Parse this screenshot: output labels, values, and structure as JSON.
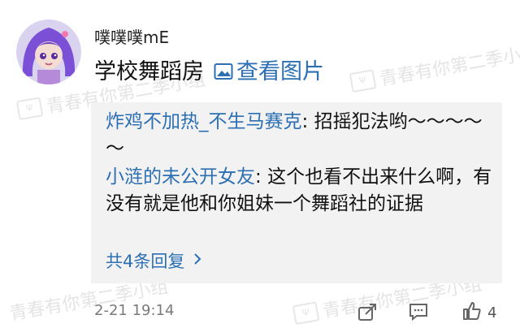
{
  "comment": {
    "username": "噗噗噗mE",
    "text": "学校舞蹈房",
    "view_image_label": "查看图片",
    "timestamp": "2-21 19:14",
    "like_count": "4"
  },
  "replies": [
    {
      "author": "炸鸡不加热_不生马赛克",
      "separator": ": ",
      "text": "招摇犯法哟～～～～～"
    },
    {
      "author": "小涟的未公开女友",
      "separator": ": ",
      "text": "这个也看不出来什么啊，有没有就是他和你姐妹一个舞蹈社的证据"
    }
  ],
  "more_replies_label": "共4条回复",
  "watermark_text": "青春有你第二季小组",
  "colors": {
    "link": "#2c6fb3",
    "reply_bg": "#f2f2f2",
    "avatar_hair": "#7b4fd6"
  },
  "icons": {
    "view_image": "image-icon",
    "more": "chevron-right-icon",
    "share": "share-icon",
    "reply": "comment-icon",
    "like": "thumbs-up-icon"
  }
}
